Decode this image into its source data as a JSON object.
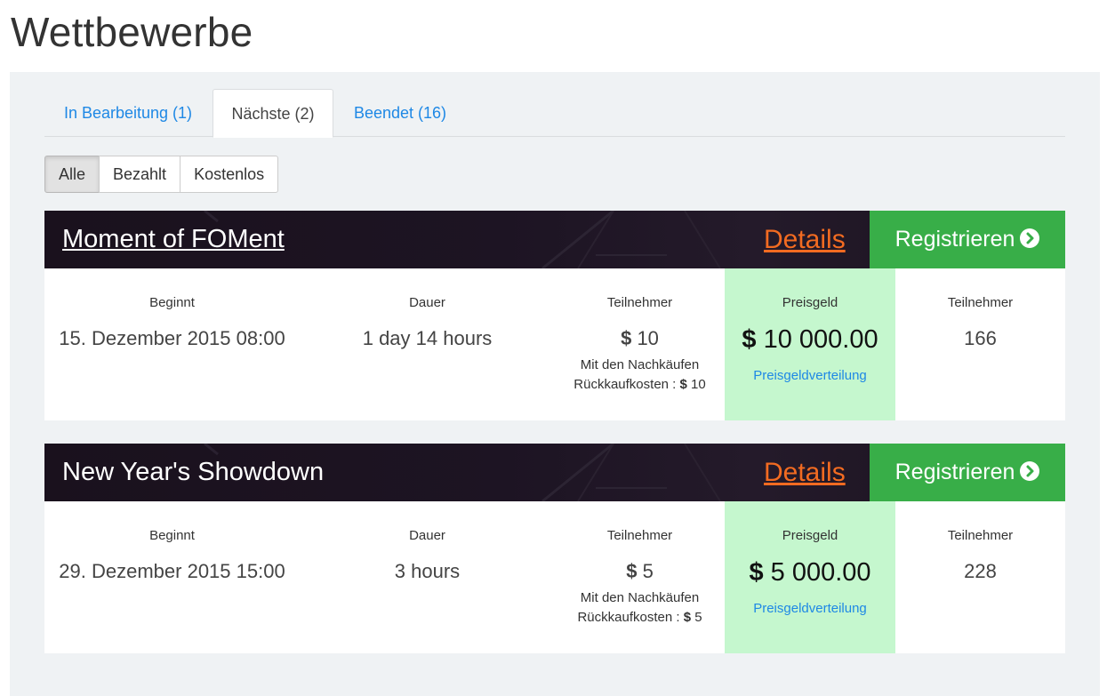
{
  "page": {
    "title": "Wettbewerbe"
  },
  "tabs": [
    {
      "label": "In Bearbeitung (1)"
    },
    {
      "label": "Nächste (2)"
    },
    {
      "label": "Beendet (16)"
    }
  ],
  "filters": [
    {
      "label": "Alle"
    },
    {
      "label": "Bezahlt"
    },
    {
      "label": "Kostenlos"
    }
  ],
  "tournaments": [
    {
      "title": "Moment of FOMent",
      "details": "Details",
      "register": "Registrieren",
      "start_label": "Beginnt",
      "start": "15. Dezember 2015 08:00",
      "duration_label": "Dauer",
      "duration": "1 day 14 hours",
      "buyin_label": "Teilnehmer",
      "buyin_currency": "$",
      "buyin": "10",
      "rebuy_note": "Mit den Nachkäufen",
      "rebuy_label": "Rückkaufkosten :",
      "rebuy_currency": "$",
      "rebuy": "10",
      "prize_label": "Preisgeld",
      "prize_currency": "$",
      "prize": "10 000.00",
      "prize_link": "Preisgeldverteilung",
      "players_label": "Teilnehmer",
      "players": "166"
    },
    {
      "title": "New Year's Showdown",
      "details": "Details",
      "register": "Registrieren",
      "start_label": "Beginnt",
      "start": "29. Dezember 2015 15:00",
      "duration_label": "Dauer",
      "duration": "3 hours",
      "buyin_label": "Teilnehmer",
      "buyin_currency": "$",
      "buyin": "5",
      "rebuy_note": "Mit den Nachkäufen",
      "rebuy_label": "Rückkaufkosten :",
      "rebuy_currency": "$",
      "rebuy": "5",
      "prize_label": "Preisgeld",
      "prize_currency": "$",
      "prize": "5 000.00",
      "prize_link": "Preisgeldverteilung",
      "players_label": "Teilnehmer",
      "players": "228"
    }
  ],
  "colors": {
    "accent_link": "#1e88e5",
    "details_link": "#f26b21",
    "register_green": "#38ae48",
    "prize_bg": "#c5f7ce",
    "header_dark": "#1d1423"
  }
}
